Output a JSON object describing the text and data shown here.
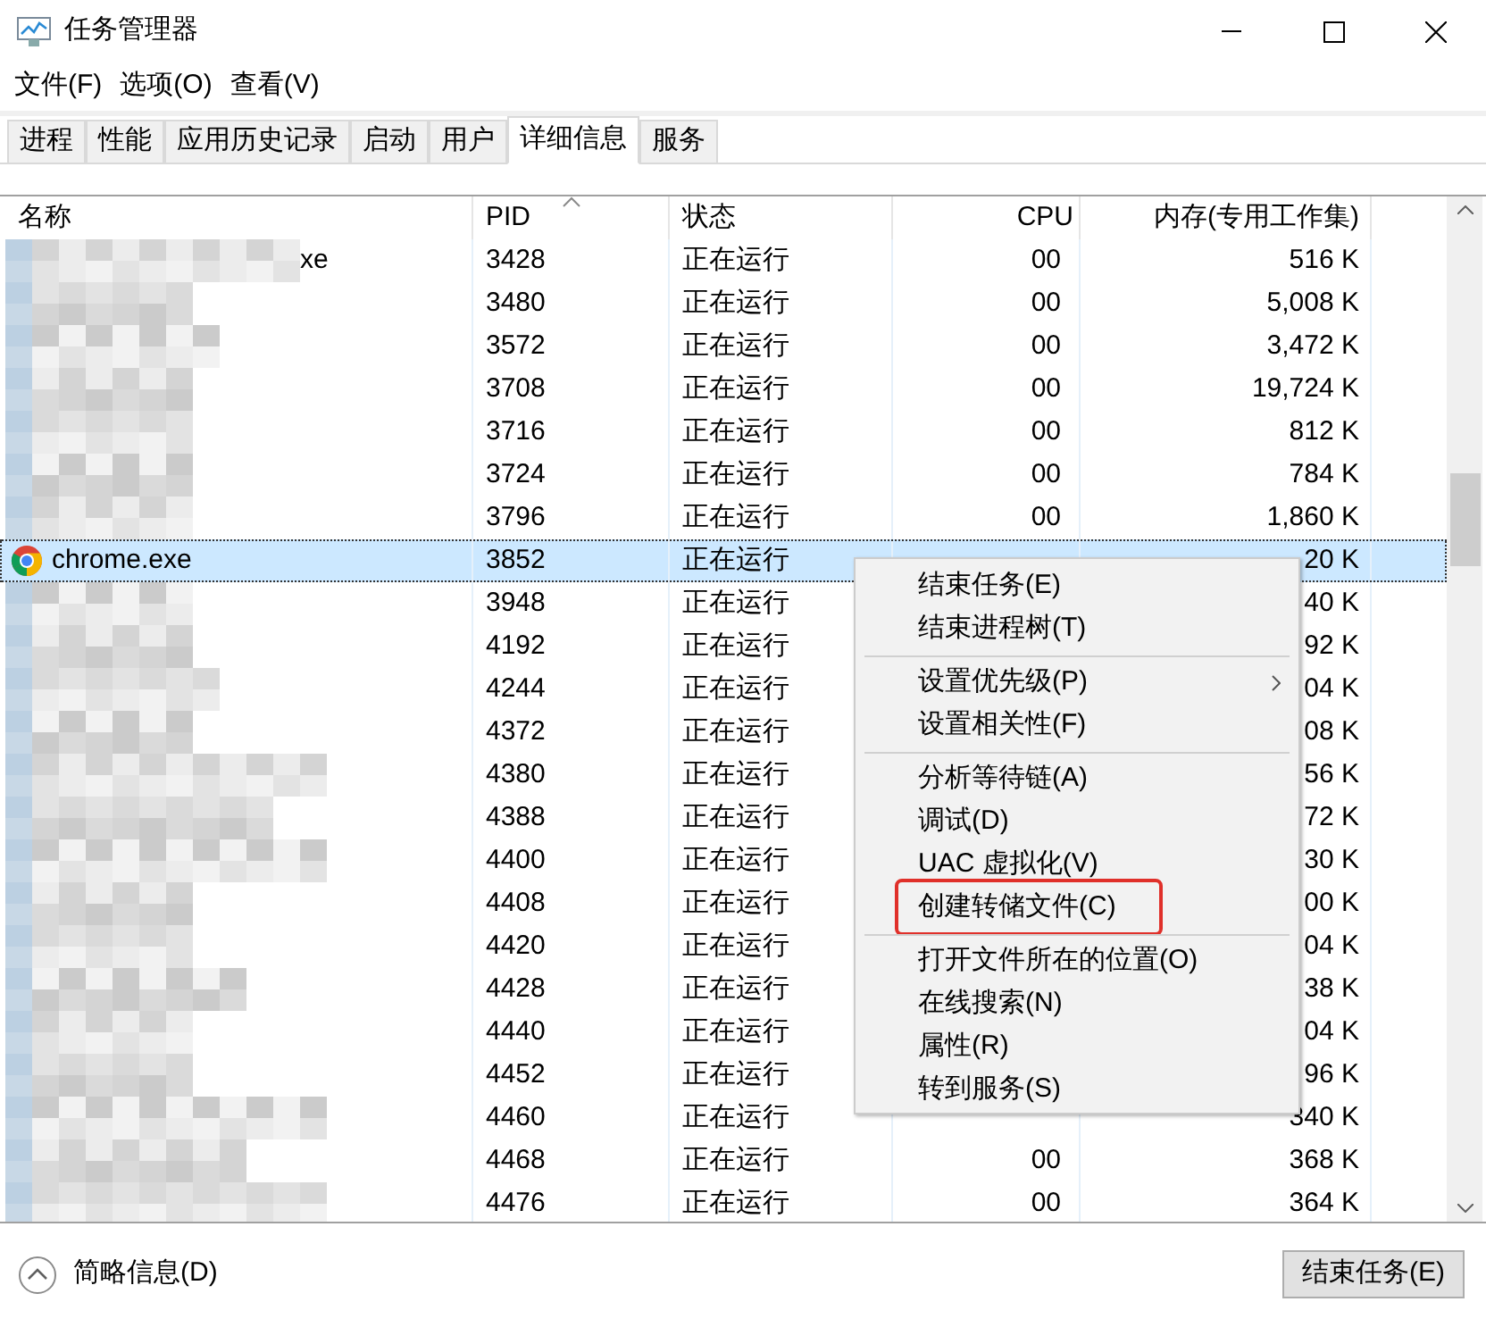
{
  "window": {
    "title": "任务管理器"
  },
  "menu_bar": [
    "文件(F)",
    "选项(O)",
    "查看(V)"
  ],
  "tabs": [
    {
      "label": "进程",
      "selected": false
    },
    {
      "label": "性能",
      "selected": false
    },
    {
      "label": "应用历史记录",
      "selected": false
    },
    {
      "label": "启动",
      "selected": false
    },
    {
      "label": "用户",
      "selected": false
    },
    {
      "label": "详细信息",
      "selected": true
    },
    {
      "label": "服务",
      "selected": false
    }
  ],
  "table": {
    "columns": [
      "名称",
      "PID",
      "状态",
      "CPU",
      "内存(专用工作集)"
    ],
    "rows": [
      {
        "name": "xe",
        "pid": "3428",
        "status": "正在运行",
        "cpu": "00",
        "memory": "516 K",
        "selected": false
      },
      {
        "pid": "3480",
        "status": "正在运行",
        "cpu": "00",
        "memory": "5,008 K",
        "selected": false
      },
      {
        "pid": "3572",
        "status": "正在运行",
        "cpu": "00",
        "memory": "3,472 K",
        "selected": false
      },
      {
        "pid": "3708",
        "status": "正在运行",
        "cpu": "00",
        "memory": "19,724 K",
        "selected": false
      },
      {
        "pid": "3716",
        "status": "正在运行",
        "cpu": "00",
        "memory": "812 K",
        "selected": false
      },
      {
        "pid": "3724",
        "status": "正在运行",
        "cpu": "00",
        "memory": "784 K",
        "selected": false
      },
      {
        "pid": "3796",
        "status": "正在运行",
        "cpu": "00",
        "memory": "1,860 K",
        "selected": false
      },
      {
        "name": "chrome.exe",
        "pid": "3852",
        "status": "正在运行",
        "memory": "20 K",
        "selected": true
      },
      {
        "pid": "3948",
        "status": "正在运行",
        "memory": "40 K",
        "selected": false
      },
      {
        "pid": "4192",
        "status": "正在运行",
        "memory": "92 K",
        "selected": false
      },
      {
        "pid": "4244",
        "status": "正在运行",
        "memory": "04 K",
        "selected": false
      },
      {
        "pid": "4372",
        "status": "正在运行",
        "memory": "08 K",
        "selected": false
      },
      {
        "pid": "4380",
        "status": "正在运行",
        "memory": "56 K",
        "selected": false
      },
      {
        "pid": "4388",
        "status": "正在运行",
        "memory": "72 K",
        "selected": false
      },
      {
        "pid": "4400",
        "status": "正在运行",
        "memory": "30 K",
        "selected": false
      },
      {
        "pid": "4408",
        "status": "正在运行",
        "memory": "00 K",
        "selected": false
      },
      {
        "pid": "4420",
        "status": "正在运行",
        "memory": "04 K",
        "selected": false
      },
      {
        "pid": "4428",
        "status": "正在运行",
        "memory": "38 K",
        "selected": false
      },
      {
        "pid": "4440",
        "status": "正在运行",
        "memory": "04 K",
        "selected": false
      },
      {
        "pid": "4452",
        "status": "正在运行",
        "memory": "96 K",
        "selected": false
      },
      {
        "pid": "4460",
        "status": "正在运行",
        "memory": "340 K",
        "selected": false
      },
      {
        "pid": "4468",
        "status": "正在运行",
        "cpu": "00",
        "memory": "368 K",
        "selected": false
      },
      {
        "pid": "4476",
        "status": "正在运行",
        "cpu": "00",
        "memory": "364 K",
        "selected": false
      }
    ]
  },
  "context_menu": {
    "groups": [
      [
        {
          "label": "结束任务(E)"
        },
        {
          "label": "结束进程树(T)"
        }
      ],
      [
        {
          "label": "设置优先级(P)",
          "submenu": true
        },
        {
          "label": "设置相关性(F)"
        }
      ],
      [
        {
          "label": "分析等待链(A)"
        },
        {
          "label": "调试(D)"
        },
        {
          "label": "UAC 虚拟化(V)"
        },
        {
          "label": "创建转储文件(C)",
          "highlighted": true
        }
      ],
      [
        {
          "label": "打开文件所在的位置(O)"
        },
        {
          "label": "在线搜索(N)"
        },
        {
          "label": "属性(R)"
        },
        {
          "label": "转到服务(S)"
        }
      ]
    ]
  },
  "footer": {
    "details_link": "简略信息(D)",
    "end_task_button": "结束任务(E)"
  }
}
